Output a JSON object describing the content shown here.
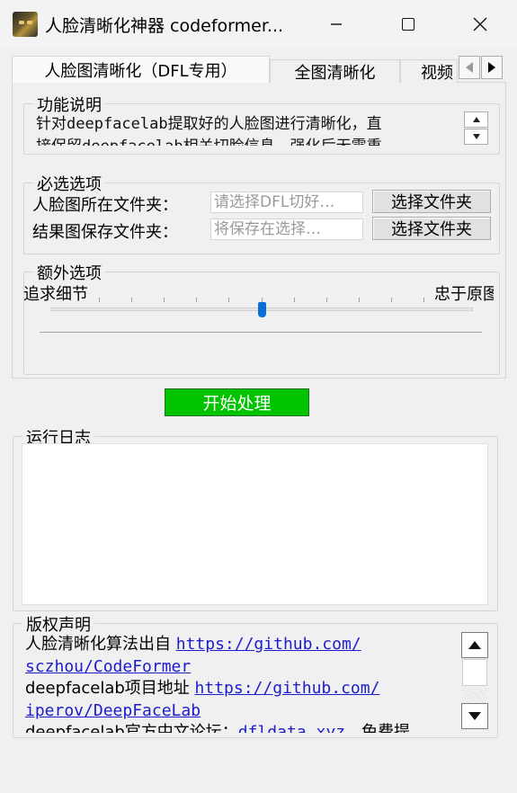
{
  "window": {
    "title": "人脸清晰化神器 codeformer...",
    "minimize_glyph": "—",
    "icon": "app-portrait-icon"
  },
  "tabs": [
    {
      "label": "人脸图清晰化（DFL专用）",
      "selected": true
    },
    {
      "label": "全图清晰化",
      "selected": false
    },
    {
      "label": "视频",
      "selected": false
    }
  ],
  "tab_scroll": {
    "left": "◀",
    "right": "▶"
  },
  "description": {
    "label": "功能说明",
    "line1": "针对deepfacelab提取好的人脸图进行清晰化，直",
    "line2": "接保留deepfacelab相关切脸信息，强化后无需重"
  },
  "required": {
    "label": "必选选项",
    "source_label": "人脸图所在文件夹：",
    "source_placeholder": "请选择DFL切好…",
    "source_button": "选择文件夹",
    "dest_label": "结果图保存文件夹：",
    "dest_placeholder": "将保存在选择…",
    "dest_button": "选择文件夹"
  },
  "extra": {
    "label": "额外选项",
    "slider_left_label": "追求细节",
    "slider_right_label": "忠于原图",
    "slider_value_fraction": 0.5,
    "tick_count": 11
  },
  "start_button": "开始处理",
  "log": {
    "label": "运行日志",
    "content": ""
  },
  "copyright": {
    "label": "版权声明",
    "line1_text": "人脸清晰化算法出自 ",
    "line1_link": "https://github.com/",
    "line2_link": "sczhou/CodeFormer",
    "line3_text": "deepfacelab项目地址 ",
    "line3_link": "https://github.com/",
    "line4_link": "iperov/DeepFaceLab",
    "line5_text": "deepfacelab官方中文论坛：",
    "line5_link": "dfldata.xyz",
    "line5_tail": "，免费提"
  },
  "colors": {
    "start_button_bg": "#00c400",
    "link": "#1c1ccc",
    "slider_thumb": "#0a6fd6"
  }
}
